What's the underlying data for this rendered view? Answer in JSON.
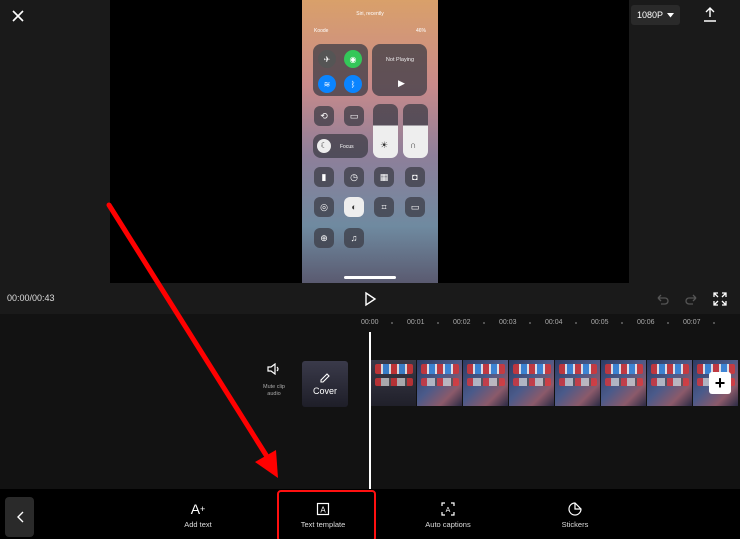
{
  "header": {
    "resolution_label": "1080P"
  },
  "phone": {
    "status_top": "Siri, recently",
    "carrier": "Koode",
    "battery": "46%",
    "now_playing": "Not Playing",
    "focus_label": "Focus"
  },
  "controls": {
    "timecode": "00:00/00:43"
  },
  "timeline": {
    "ticks": [
      "00:00",
      "00:01",
      "00:02",
      "00:03",
      "00:04",
      "00:05",
      "00:06",
      "00:07"
    ],
    "mute_label": "Mute clip audio",
    "cover_label": "Cover"
  },
  "toolbar": {
    "add_text": "Add text",
    "text_template": "Text template",
    "auto_captions": "Auto captions",
    "stickers": "Stickers"
  },
  "colors": {
    "highlight": "#ff1010",
    "background": "#000000"
  },
  "icons": [
    "close-icon",
    "chevron-down-icon",
    "export-icon",
    "play-icon",
    "undo-icon",
    "redo-icon",
    "fullscreen-icon",
    "speaker-icon",
    "edit-icon",
    "plus-icon",
    "chevron-left-icon",
    "add-text-icon",
    "text-template-icon",
    "auto-captions-icon",
    "stickers-icon"
  ]
}
